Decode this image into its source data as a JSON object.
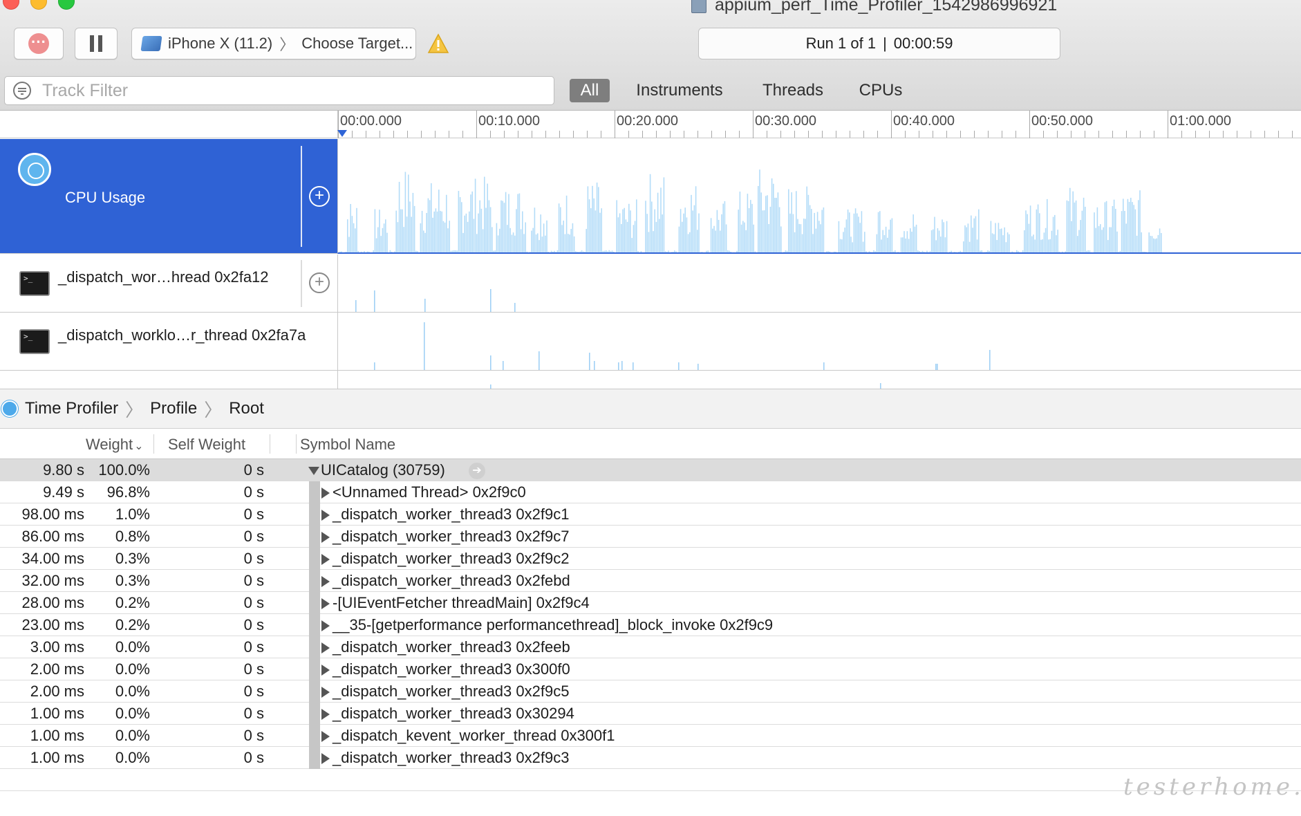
{
  "window": {
    "title": "appium_perf_Time_Profiler_1542986996921"
  },
  "toolbar": {
    "target_device": "iPhone X (11.2)",
    "target_sep": "〉",
    "target_app": "Choose Target...",
    "run_label": "Run 1 of 1",
    "run_sep": "|",
    "run_time": "00:00:59"
  },
  "filter": {
    "placeholder": "Track Filter",
    "scopes": [
      "All",
      "Instruments",
      "Threads",
      "CPUs"
    ],
    "active_scope": "All"
  },
  "timeline": {
    "ticks": [
      "00:00.000",
      "00:10.000",
      "00:20.000",
      "00:30.000",
      "00:40.000",
      "00:50.000",
      "01:00.000"
    ]
  },
  "tracks": [
    {
      "label": "CPU Usage",
      "kind": "cpu",
      "selected": true,
      "icon": "cpu-usage-icon"
    },
    {
      "label": "_dispatch_wor…hread  0x2fa12",
      "kind": "thread",
      "icon": "terminal-icon"
    },
    {
      "label": "_dispatch_worklo…r_thread  0x2fa7a",
      "kind": "thread",
      "icon": "terminal-icon"
    }
  ],
  "profiler": {
    "breadcrumb": [
      "Time Profiler",
      "Profile",
      "Root"
    ],
    "columns": {
      "weight": "Weight",
      "self_weight": "Self Weight",
      "symbol": "Symbol Name"
    },
    "rows": [
      {
        "weight": "9.80 s",
        "pct": "100.0%",
        "self": "0 s",
        "symbol": "UICatalog (30759)",
        "root": true
      },
      {
        "weight": "9.49 s",
        "pct": "96.8%",
        "self": "0 s",
        "symbol": "<Unnamed Thread> 0x2f9c0"
      },
      {
        "weight": "98.00 ms",
        "pct": "1.0%",
        "self": "0 s",
        "symbol": "_dispatch_worker_thread3  0x2f9c1"
      },
      {
        "weight": "86.00 ms",
        "pct": "0.8%",
        "self": "0 s",
        "symbol": "_dispatch_worker_thread3  0x2f9c7"
      },
      {
        "weight": "34.00 ms",
        "pct": "0.3%",
        "self": "0 s",
        "symbol": "_dispatch_worker_thread3  0x2f9c2"
      },
      {
        "weight": "32.00 ms",
        "pct": "0.3%",
        "self": "0 s",
        "symbol": "_dispatch_worker_thread3  0x2febd"
      },
      {
        "weight": "28.00 ms",
        "pct": "0.2%",
        "self": "0 s",
        "symbol": "-[UIEventFetcher threadMain]  0x2f9c4"
      },
      {
        "weight": "23.00 ms",
        "pct": "0.2%",
        "self": "0 s",
        "symbol": "__35-[getperformance performancethread]_block_invoke  0x2f9c9"
      },
      {
        "weight": "3.00 ms",
        "pct": "0.0%",
        "self": "0 s",
        "symbol": "_dispatch_worker_thread3  0x2feeb"
      },
      {
        "weight": "2.00 ms",
        "pct": "0.0%",
        "self": "0 s",
        "symbol": "_dispatch_worker_thread3  0x300f0"
      },
      {
        "weight": "2.00 ms",
        "pct": "0.0%",
        "self": "0 s",
        "symbol": "_dispatch_worker_thread3  0x2f9c5"
      },
      {
        "weight": "1.00 ms",
        "pct": "0.0%",
        "self": "0 s",
        "symbol": "_dispatch_worker_thread3  0x30294"
      },
      {
        "weight": "1.00 ms",
        "pct": "0.0%",
        "self": "0 s",
        "symbol": "_dispatch_kevent_worker_thread  0x300f1"
      },
      {
        "weight": "1.00 ms",
        "pct": "0.0%",
        "self": "0 s",
        "symbol": "_dispatch_worker_thread3  0x2f9c3"
      }
    ]
  },
  "watermark": "testerhome.com",
  "colors": {
    "selection_blue": "#2f62d5",
    "cpu_bar": "#b3dcf8",
    "thread_bar": "#9fd0f5"
  }
}
